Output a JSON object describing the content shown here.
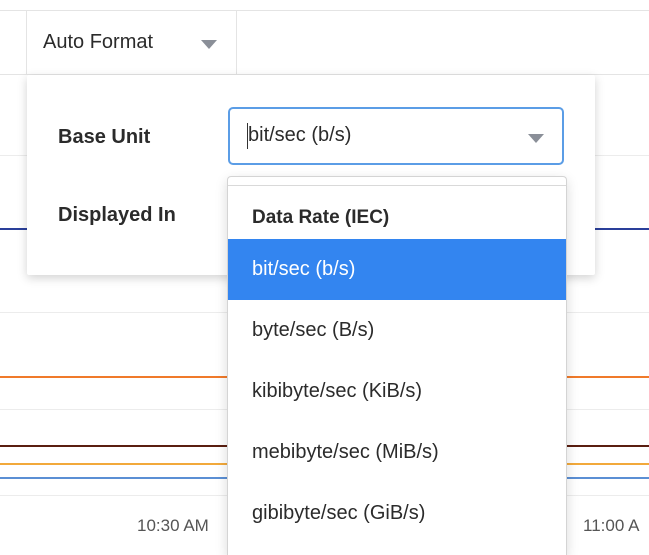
{
  "toolbar": {
    "format_label": "Auto Format"
  },
  "settings": {
    "base_unit_label": "Base Unit",
    "displayed_in_label": "Displayed In",
    "base_unit_value": "bit/sec (b/s)"
  },
  "dropdown": {
    "group_header": "Data Rate (IEC)",
    "selected_index": 0,
    "options": [
      {
        "label": "bit/sec (b/s)"
      },
      {
        "label": "byte/sec (B/s)"
      },
      {
        "label": "kibibyte/sec (KiB/s)"
      },
      {
        "label": "mebibyte/sec (MiB/s)"
      },
      {
        "label": "gibibyte/sec (GiB/s)"
      }
    ]
  },
  "chart": {
    "x_ticks": [
      "10:30 AM",
      "11:00 A"
    ],
    "series_colors": {
      "navy": "#2a3f9a",
      "orange": "#f07a2a",
      "dark_brown": "#5a1e10",
      "amber": "#f2a93b",
      "blue": "#5b8fd4"
    }
  },
  "colors": {
    "accent": "#3385f0",
    "focus_border": "#5b9de6"
  },
  "icons": {
    "format_caret": "chevron-down-icon",
    "select_caret": "chevron-down-icon"
  }
}
